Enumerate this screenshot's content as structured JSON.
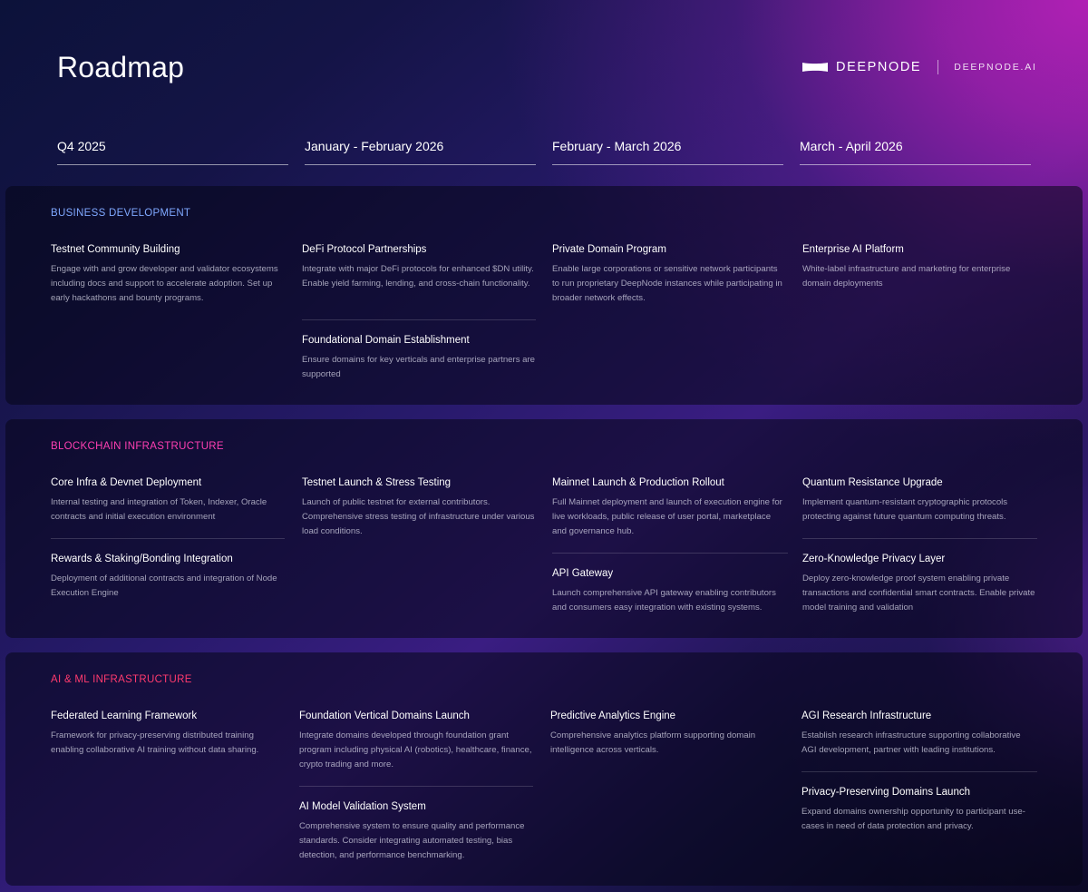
{
  "header": {
    "title": "Roadmap",
    "brand_name": "DEEPNODE",
    "brand_site": "DEEPNODE.AI",
    "logo_icon": "bowtie-logo-icon"
  },
  "timeline": [
    "Q4 2025",
    "January - February 2026",
    "February - March 2026",
    "March - April 2026"
  ],
  "colors": {
    "business": "#7fa8ff",
    "blockchain": "#ff3fb2",
    "ai": "#ff3a6e"
  },
  "sections": {
    "business": {
      "title": "BUSINESS DEVELOPMENT",
      "items": [
        {
          "title": "Testnet Community Building",
          "desc": "Engage with and grow developer and validator ecosystems including docs and support to accelerate adoption. Set up early hackathons and bounty programs."
        },
        {
          "title": "DeFi Protocol Partnerships",
          "desc": "Integrate with major DeFi protocols for enhanced $DN utility. Enable yield farming, lending, and cross-chain functionality."
        },
        {
          "title": "Foundational Domain Establishment",
          "desc": "Ensure domains for key verticals and enterprise partners are supported"
        },
        {
          "title": "Private Domain Program",
          "desc": "Enable large corporations or sensitive network participants to run proprietary DeepNode instances while participating in broader network effects."
        },
        {
          "title": "Enterprise AI Platform",
          "desc": "White-label infrastructure and marketing for enterprise domain deployments"
        }
      ]
    },
    "blockchain": {
      "title": "BLOCKCHAIN INFRASTRUCTURE",
      "items": [
        {
          "title": "Core Infra & Devnet Deployment",
          "desc": "Internal testing and integration of Token, Indexer, Oracle contracts and initial execution environment"
        },
        {
          "title": "Rewards & Staking/Bonding Integration",
          "desc": "Deployment of additional contracts and integration of Node Execution Engine"
        },
        {
          "title": "Testnet Launch & Stress Testing",
          "desc": "Launch of public testnet for external contributors. Comprehensive stress testing of infrastructure under various load conditions."
        },
        {
          "title": "Mainnet Launch & Production Rollout",
          "desc": "Full Mainnet deployment and launch of execution engine for live workloads, public release of user portal, marketplace and governance hub."
        },
        {
          "title": "API Gateway",
          "desc": "Launch comprehensive API gateway enabling contributors and consumers easy integration with existing systems."
        },
        {
          "title": "Quantum Resistance Upgrade",
          "desc": "Implement quantum-resistant cryptographic protocols protecting against future quantum computing threats."
        },
        {
          "title": "Zero-Knowledge Privacy Layer",
          "desc": "Deploy zero-knowledge proof system enabling private transactions and confidential smart contracts. Enable private model training and validation"
        }
      ]
    },
    "ai": {
      "title": "AI & ML INFRASTRUCTURE",
      "items": [
        {
          "title": "Federated Learning Framework",
          "desc": "Framework for privacy-preserving distributed training enabling collaborative AI training without data sharing."
        },
        {
          "title": "Foundation Vertical Domains Launch",
          "desc": "Integrate domains developed through foundation grant program including physical AI (robotics), healthcare, finance, crypto trading and more."
        },
        {
          "title": "AI Model Validation System",
          "desc": "Comprehensive system to ensure quality and performance standards. Consider integrating automated testing, bias detection, and performance benchmarking."
        },
        {
          "title": "Predictive Analytics Engine",
          "desc": "Comprehensive analytics platform supporting domain intelligence across verticals."
        },
        {
          "title": "AGI Research Infrastructure",
          "desc": "Establish research infrastructure supporting collaborative AGI development, partner with leading institutions."
        },
        {
          "title": "Privacy-Preserving Domains Launch",
          "desc": "Expand domains ownership opportunity to participant use-cases in need of data protection and privacy."
        }
      ]
    }
  }
}
